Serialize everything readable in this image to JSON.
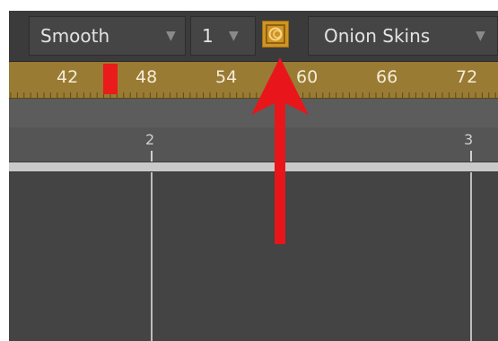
{
  "toolbar": {
    "interpolation_value": "Smooth",
    "step_value": "1",
    "onion_skins_label": "Onion Skins",
    "dropdown_arrow": "▼"
  },
  "ruler": {
    "labels": [
      "42",
      "48",
      "54",
      "60",
      "66",
      "72"
    ]
  },
  "track": {
    "labels": [
      "2",
      "3"
    ]
  },
  "colors": {
    "ruler_bg": "#9a7b34",
    "onion_button": "#cf9422",
    "playhead": "#ea1b1b",
    "annotation_arrow": "#e8161b"
  },
  "icons": {
    "onion_skin_toggle": "onion-skin-icon",
    "annotation": "red-arrow-annotation"
  }
}
